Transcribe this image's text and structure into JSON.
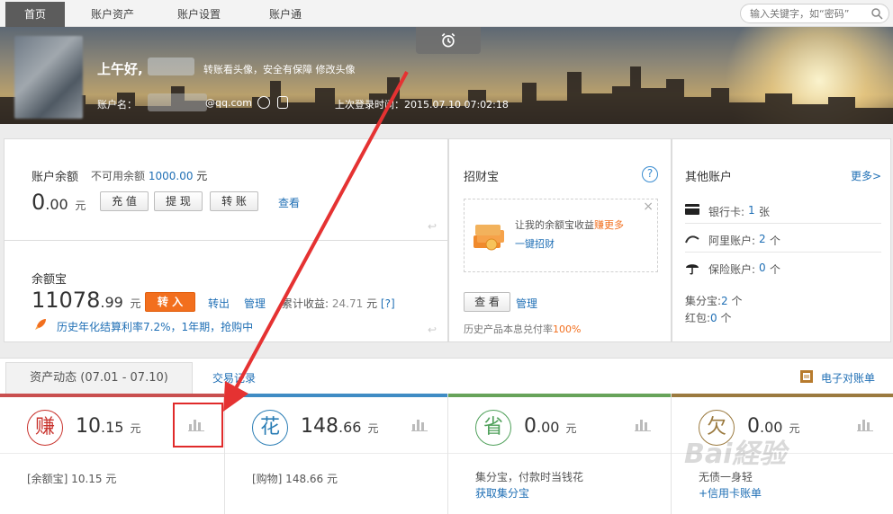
{
  "nav": {
    "tabs": [
      "首页",
      "账户资产",
      "账户设置",
      "账户通"
    ],
    "search_placeholder": "输入关键字，如“密码”"
  },
  "banner": {
    "greeting": "上午好,",
    "links": "转账看头像，安全有保障  修改头像",
    "account_label": "账户名：",
    "email_suffix": "@qq.com",
    "last_login": "上次登录时间：2015.07.10 07:02:18"
  },
  "balance": {
    "title": "账户余额",
    "unavailable_label": "不可用余额",
    "unavailable_value": "1000.00",
    "unavailable_unit": "元",
    "amount_int": "0",
    "amount_dec": ".00",
    "unit": "元",
    "buttons": [
      "充 值",
      "提 现",
      "转 账"
    ],
    "view_link": "查看"
  },
  "yuebao": {
    "title": "余额宝",
    "amount_int": "11078",
    "amount_dec": ".99",
    "unit": "元",
    "transfer_in": "转 入",
    "transfer_out": "转出",
    "manage": "管理",
    "cumulative_label": "累计收益:",
    "cumulative_value": "24.71",
    "cumulative_unit": "元",
    "help": "[?]",
    "promo": "历史年化结算利率7.2%，1年期，抢购中"
  },
  "zhaocaibao": {
    "title": "招财宝",
    "help": "?",
    "promo_text": "让我的余额宝收益",
    "promo_highlight": "赚更多",
    "promo_link": "一键招财",
    "view_button": "查 看",
    "manage": "管理",
    "note": "历史产品本息兑付率",
    "note_value": "100%"
  },
  "other_accounts": {
    "title": "其他账户",
    "more": "更多>",
    "rows": [
      {
        "icon": "bank-card-icon",
        "label": "银行卡:",
        "value": "1",
        "unit": "张"
      },
      {
        "icon": "alibaba-icon",
        "label": "阿里账户:",
        "value": "2",
        "unit": "个"
      },
      {
        "icon": "umbrella-icon",
        "label": "保险账户:",
        "value": "0",
        "unit": "个"
      }
    ],
    "jifenbao_label": "集分宝:",
    "jifenbao_value": "2",
    "jifenbao_unit": "个",
    "hongbao_label": "红包:",
    "hongbao_value": "0",
    "hongbao_unit": "个"
  },
  "dynamics": {
    "tab_label": "资产动态 (07.01 - 07.10)",
    "records_link": "交易记录",
    "statement_link": "电子对账单"
  },
  "cards": [
    {
      "glyph": "赚",
      "color": "#c8312b",
      "int": "10",
      "dec": ".15",
      "unit": "元",
      "desc": "[余额宝] 10.15 元",
      "desc2": ""
    },
    {
      "glyph": "花",
      "color": "#2a7db5",
      "int": "148",
      "dec": ".66",
      "unit": "元",
      "desc": "[购物] 148.66 元",
      "desc2": ""
    },
    {
      "glyph": "省",
      "color": "#4fa05a",
      "int": "0",
      "dec": ".00",
      "unit": "元",
      "desc": "集分宝，付款时当钱花",
      "desc2": "获取集分宝"
    },
    {
      "glyph": "欠",
      "color": "#9b7a3f",
      "int": "0",
      "dec": ".00",
      "unit": "元",
      "desc": "无债一身轻",
      "desc2": "+信用卡账单"
    }
  ],
  "colors": {
    "card_bars": [
      "#c94f4f",
      "#3f8cc4",
      "#67a35a",
      "#9b7a3f"
    ],
    "link": "#1f6fb5",
    "orange": "#f26f1e"
  }
}
